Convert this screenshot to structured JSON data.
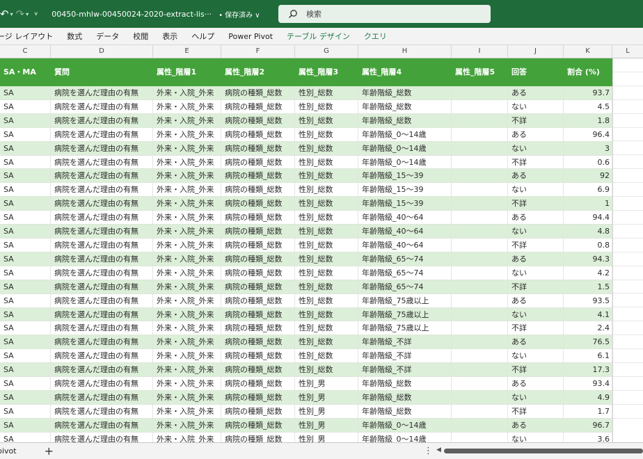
{
  "titlebar": {
    "filename": "00450-mhlw-00450024-2020-extract-lis···",
    "save_state": "保存済み",
    "search_placeholder": "検索"
  },
  "ribbon": {
    "tabs": [
      "ージ レイアウト",
      "数式",
      "データ",
      "校閲",
      "表示",
      "ヘルプ",
      "Power Pivot",
      "テーブル デザイン",
      "クエリ"
    ]
  },
  "column_headers": [
    "C",
    "D",
    "E",
    "F",
    "G",
    "H",
    "I",
    "J",
    "K",
    "L"
  ],
  "table": {
    "headers": [
      "SA・MA",
      "質問",
      "属性_階層1",
      "属性_階層2",
      "属性_階層3",
      "属性_階層4",
      "属性_階層5",
      "回答",
      "割合 (%)"
    ],
    "rows": [
      [
        "SA",
        "病院を選んだ理由の有無",
        "外来・入院_外来",
        "病院の種類_総数",
        "性別_総数",
        "年齢階級_総数",
        "",
        "ある",
        "93.7"
      ],
      [
        "SA",
        "病院を選んだ理由の有無",
        "外来・入院_外来",
        "病院の種類_総数",
        "性別_総数",
        "年齢階級_総数",
        "",
        "ない",
        "4.5"
      ],
      [
        "SA",
        "病院を選んだ理由の有無",
        "外来・入院_外来",
        "病院の種類_総数",
        "性別_総数",
        "年齢階級_総数",
        "",
        "不詳",
        "1.8"
      ],
      [
        "SA",
        "病院を選んだ理由の有無",
        "外来・入院_外来",
        "病院の種類_総数",
        "性別_総数",
        "年齢階級_0～14歳",
        "",
        "ある",
        "96.4"
      ],
      [
        "SA",
        "病院を選んだ理由の有無",
        "外来・入院_外来",
        "病院の種類_総数",
        "性別_総数",
        "年齢階級_0～14歳",
        "",
        "ない",
        "3"
      ],
      [
        "SA",
        "病院を選んだ理由の有無",
        "外来・入院_外来",
        "病院の種類_総数",
        "性別_総数",
        "年齢階級_0～14歳",
        "",
        "不詳",
        "0.6"
      ],
      [
        "SA",
        "病院を選んだ理由の有無",
        "外来・入院_外来",
        "病院の種類_総数",
        "性別_総数",
        "年齢階級_15～39",
        "",
        "ある",
        "92"
      ],
      [
        "SA",
        "病院を選んだ理由の有無",
        "外来・入院_外来",
        "病院の種類_総数",
        "性別_総数",
        "年齢階級_15～39",
        "",
        "ない",
        "6.9"
      ],
      [
        "SA",
        "病院を選んだ理由の有無",
        "外来・入院_外来",
        "病院の種類_総数",
        "性別_総数",
        "年齢階級_15～39",
        "",
        "不詳",
        "1"
      ],
      [
        "SA",
        "病院を選んだ理由の有無",
        "外来・入院_外来",
        "病院の種類_総数",
        "性別_総数",
        "年齢階級_40～64",
        "",
        "ある",
        "94.4"
      ],
      [
        "SA",
        "病院を選んだ理由の有無",
        "外来・入院_外来",
        "病院の種類_総数",
        "性別_総数",
        "年齢階級_40～64",
        "",
        "ない",
        "4.8"
      ],
      [
        "SA",
        "病院を選んだ理由の有無",
        "外来・入院_外来",
        "病院の種類_総数",
        "性別_総数",
        "年齢階級_40～64",
        "",
        "不詳",
        "0.8"
      ],
      [
        "SA",
        "病院を選んだ理由の有無",
        "外来・入院_外来",
        "病院の種類_総数",
        "性別_総数",
        "年齢階級_65～74",
        "",
        "ある",
        "94.3"
      ],
      [
        "SA",
        "病院を選んだ理由の有無",
        "外来・入院_外来",
        "病院の種類_総数",
        "性別_総数",
        "年齢階級_65～74",
        "",
        "ない",
        "4.2"
      ],
      [
        "SA",
        "病院を選んだ理由の有無",
        "外来・入院_外来",
        "病院の種類_総数",
        "性別_総数",
        "年齢階級_65～74",
        "",
        "不詳",
        "1.5"
      ],
      [
        "SA",
        "病院を選んだ理由の有無",
        "外来・入院_外来",
        "病院の種類_総数",
        "性別_総数",
        "年齢階級_75歳以上",
        "",
        "ある",
        "93.5"
      ],
      [
        "SA",
        "病院を選んだ理由の有無",
        "外来・入院_外来",
        "病院の種類_総数",
        "性別_総数",
        "年齢階級_75歳以上",
        "",
        "ない",
        "4.1"
      ],
      [
        "SA",
        "病院を選んだ理由の有無",
        "外来・入院_外来",
        "病院の種類_総数",
        "性別_総数",
        "年齢階級_75歳以上",
        "",
        "不詳",
        "2.4"
      ],
      [
        "SA",
        "病院を選んだ理由の有無",
        "外来・入院_外来",
        "病院の種類_総数",
        "性別_総数",
        "年齢階級_不詳",
        "",
        "ある",
        "76.5"
      ],
      [
        "SA",
        "病院を選んだ理由の有無",
        "外来・入院_外来",
        "病院の種類_総数",
        "性別_総数",
        "年齢階級_不詳",
        "",
        "ない",
        "6.1"
      ],
      [
        "SA",
        "病院を選んだ理由の有無",
        "外来・入院_外来",
        "病院の種類_総数",
        "性別_総数",
        "年齢階級_不詳",
        "",
        "不詳",
        "17.3"
      ],
      [
        "SA",
        "病院を選んだ理由の有無",
        "外来・入院_外来",
        "病院の種類_総数",
        "性別_男",
        "年齢階級_総数",
        "",
        "ある",
        "93.4"
      ],
      [
        "SA",
        "病院を選んだ理由の有無",
        "外来・入院_外来",
        "病院の種類_総数",
        "性別_男",
        "年齢階級_総数",
        "",
        "ない",
        "4.9"
      ],
      [
        "SA",
        "病院を選んだ理由の有無",
        "外来・入院_外来",
        "病院の種類_総数",
        "性別_男",
        "年齢階級_総数",
        "",
        "不詳",
        "1.7"
      ],
      [
        "SA",
        "病院を選んだ理由の有無",
        "外来・入院_外来",
        "病院の種類_総数",
        "性別_男",
        "年齢階級_0～14歳",
        "",
        "ある",
        "96.7"
      ],
      [
        "SA",
        "病院を選んだ理由の有無",
        "外来・入院_外来",
        "病院の種類_総数",
        "性別_男",
        "年齢階級_0～14歳",
        "",
        "ない",
        "3.6"
      ]
    ]
  },
  "bottombar": {
    "sheet_tab": "pivot",
    "add_sheet": "+",
    "more": "⋮"
  },
  "colors": {
    "titlebar": "#1f6b3a",
    "header_fill": "#43a23a",
    "band_fill": "#dcefd8",
    "context_tab": "#1e7a45"
  },
  "icons": [
    "undo-icon",
    "redo-icon",
    "customize-qat-icon",
    "search-icon",
    "chevron-down-icon",
    "add-sheet-icon",
    "more-options-icon",
    "scroll-left-icon"
  ]
}
